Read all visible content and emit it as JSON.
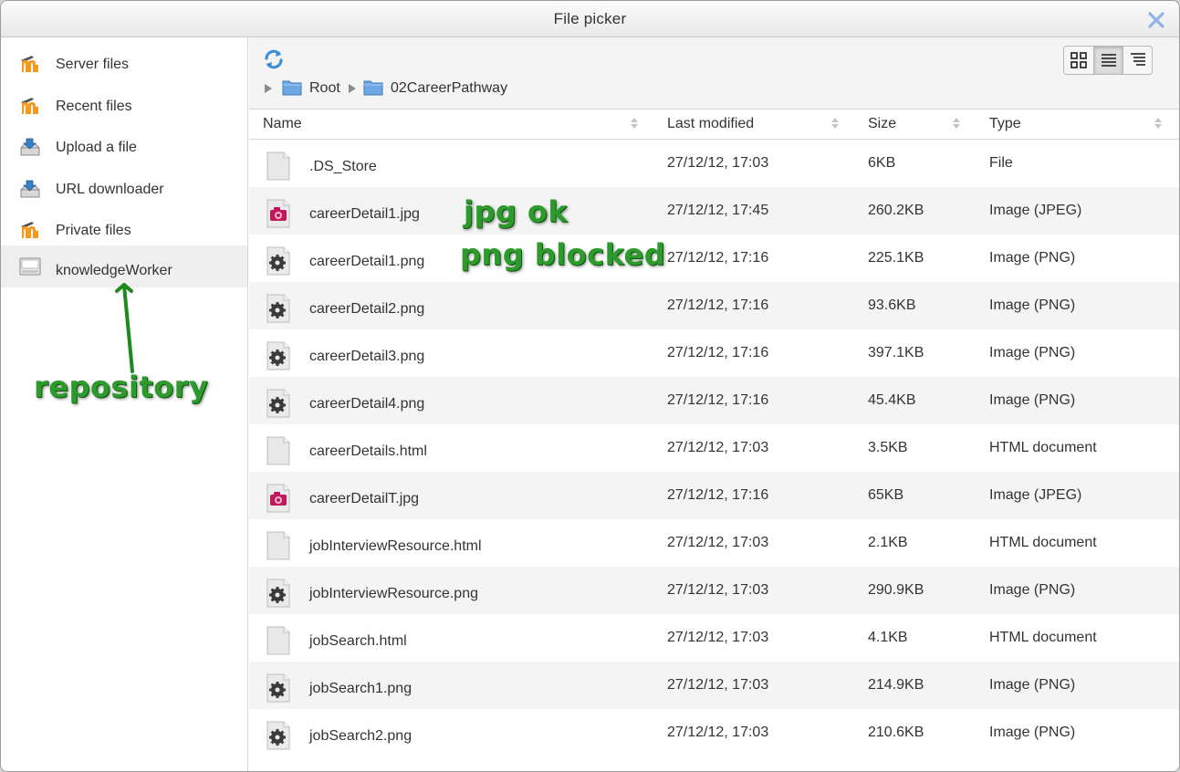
{
  "dialog": {
    "title": "File picker"
  },
  "sidebar": {
    "items": [
      {
        "label": "Server files",
        "icon": "moodle-icon"
      },
      {
        "label": "Recent files",
        "icon": "moodle-icon"
      },
      {
        "label": "Upload a file",
        "icon": "upload-icon"
      },
      {
        "label": "URL downloader",
        "icon": "url-download-icon"
      },
      {
        "label": "Private files",
        "icon": "moodle-icon"
      },
      {
        "label": "knowledgeWorker",
        "icon": "repository-icon",
        "active": true
      }
    ]
  },
  "breadcrumb": {
    "items": [
      "Root",
      "02CareerPathway"
    ]
  },
  "view_modes": {
    "options": [
      "icons",
      "list",
      "tree"
    ],
    "selected": "list"
  },
  "table": {
    "columns": [
      "Name",
      "Last modified",
      "Size",
      "Type"
    ],
    "rows": [
      {
        "name": ".DS_Store",
        "modified": "27/12/12, 17:03",
        "size": "6KB",
        "type": "File",
        "icon": "file-icon"
      },
      {
        "name": "careerDetail1.jpg",
        "modified": "27/12/12, 17:45",
        "size": "260.2KB",
        "type": "Image (JPEG)",
        "icon": "jpeg-icon"
      },
      {
        "name": "careerDetail1.png",
        "modified": "27/12/12, 17:16",
        "size": "225.1KB",
        "type": "Image (PNG)",
        "icon": "png-icon"
      },
      {
        "name": "careerDetail2.png",
        "modified": "27/12/12, 17:16",
        "size": "93.6KB",
        "type": "Image (PNG)",
        "icon": "png-icon"
      },
      {
        "name": "careerDetail3.png",
        "modified": "27/12/12, 17:16",
        "size": "397.1KB",
        "type": "Image (PNG)",
        "icon": "png-icon"
      },
      {
        "name": "careerDetail4.png",
        "modified": "27/12/12, 17:16",
        "size": "45.4KB",
        "type": "Image (PNG)",
        "icon": "png-icon"
      },
      {
        "name": "careerDetails.html",
        "modified": "27/12/12, 17:03",
        "size": "3.5KB",
        "type": "HTML document",
        "icon": "file-icon"
      },
      {
        "name": "careerDetailT.jpg",
        "modified": "27/12/12, 17:16",
        "size": "65KB",
        "type": "Image (JPEG)",
        "icon": "jpeg-icon"
      },
      {
        "name": "jobInterviewResource.html",
        "modified": "27/12/12, 17:03",
        "size": "2.1KB",
        "type": "HTML document",
        "icon": "file-icon"
      },
      {
        "name": "jobInterviewResource.png",
        "modified": "27/12/12, 17:03",
        "size": "290.9KB",
        "type": "Image (PNG)",
        "icon": "png-icon"
      },
      {
        "name": "jobSearch.html",
        "modified": "27/12/12, 17:03",
        "size": "4.1KB",
        "type": "HTML document",
        "icon": "file-icon"
      },
      {
        "name": "jobSearch1.png",
        "modified": "27/12/12, 17:03",
        "size": "214.9KB",
        "type": "Image (PNG)",
        "icon": "png-icon"
      },
      {
        "name": "jobSearch2.png",
        "modified": "27/12/12, 17:03",
        "size": "210.6KB",
        "type": "Image (PNG)",
        "icon": "png-icon"
      }
    ]
  },
  "annotations": {
    "jpg": "jpg ok",
    "png": "png blocked",
    "repository": "repository"
  },
  "colors": {
    "annotation_green": "#2c9b2c",
    "close_blue": "#8fb3e8",
    "folder_blue": "#6fa7e6",
    "moodle_orange": "#f39a1e",
    "row_alt": "#f4f4f4"
  }
}
